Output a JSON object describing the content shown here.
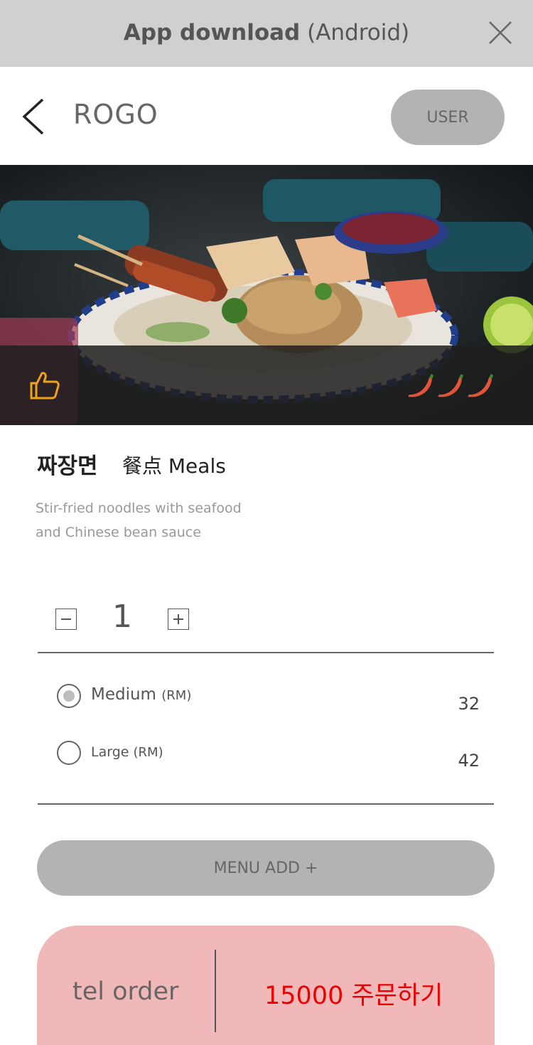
{
  "banner": {
    "title_bold": "App download",
    "title_rest": " (Android)",
    "close_icon": "close-icon"
  },
  "header": {
    "back_icon": "chevron-left-icon",
    "brand": "ROGO",
    "user_label": "USER"
  },
  "hero": {
    "like_icon": "thumbs-up-icon",
    "spice_icon": "chili-icon",
    "spice_level": 3
  },
  "dish": {
    "name": "짜장면",
    "category": "餐点 Meals",
    "description_line1": "Stir-fried noodles with seafood",
    "description_line2": "and Chinese bean sauce"
  },
  "quantity": {
    "value": "1",
    "minus_icon": "minus-icon",
    "plus_icon": "plus-icon"
  },
  "options": [
    {
      "name": "Medium",
      "unit": "(RM)",
      "price": "32",
      "selected": true
    },
    {
      "name": "Large",
      "unit": "(RM)",
      "price": "42",
      "selected": false
    }
  ],
  "menu_add": {
    "label": "MENU ADD  +"
  },
  "order": {
    "tel_label": "tel order",
    "total_label": "15000 주문하기"
  },
  "colors": {
    "banner_bg": "#d0d0d0",
    "button_gray": "#b3b3b3",
    "order_bg": "#f0b8b8",
    "order_accent": "#ee0000",
    "thumb_icon": "#f0a21c",
    "chili": "#e0553a"
  }
}
